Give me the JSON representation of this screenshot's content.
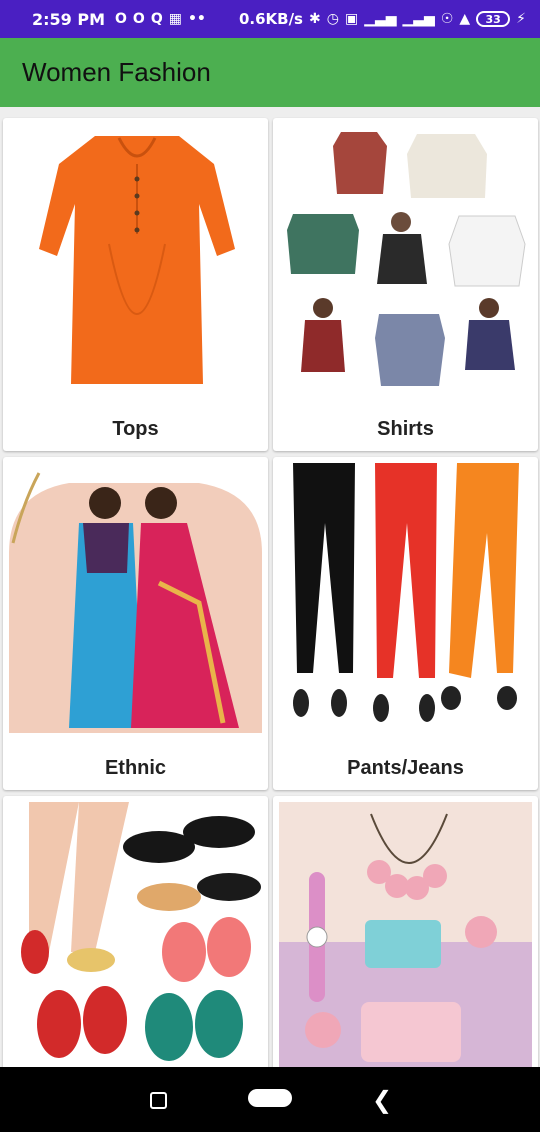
{
  "status_bar": {
    "time": "2:59 PM",
    "network_speed": "0.6KB/s",
    "battery": "33",
    "icons": [
      "o-icon",
      "o-icon",
      "q-icon",
      "gallery-icon",
      "dots-icon",
      "bluetooth-icon",
      "alarm-icon",
      "volte-icon",
      "signal-icon",
      "signal-icon",
      "hotspot-icon",
      "wifi-icon",
      "battery-icon",
      "charging-icon"
    ]
  },
  "app_bar": {
    "title": "Women Fashion",
    "color": "#4caf50"
  },
  "categories": [
    {
      "label": "Tops"
    },
    {
      "label": "Shirts"
    },
    {
      "label": "Ethnic"
    },
    {
      "label": "Pants/Jeans"
    },
    {
      "label": ""
    },
    {
      "label": ""
    }
  ],
  "nav_bar": {
    "icons": [
      "recent-apps-icon",
      "home-icon",
      "back-icon"
    ]
  }
}
